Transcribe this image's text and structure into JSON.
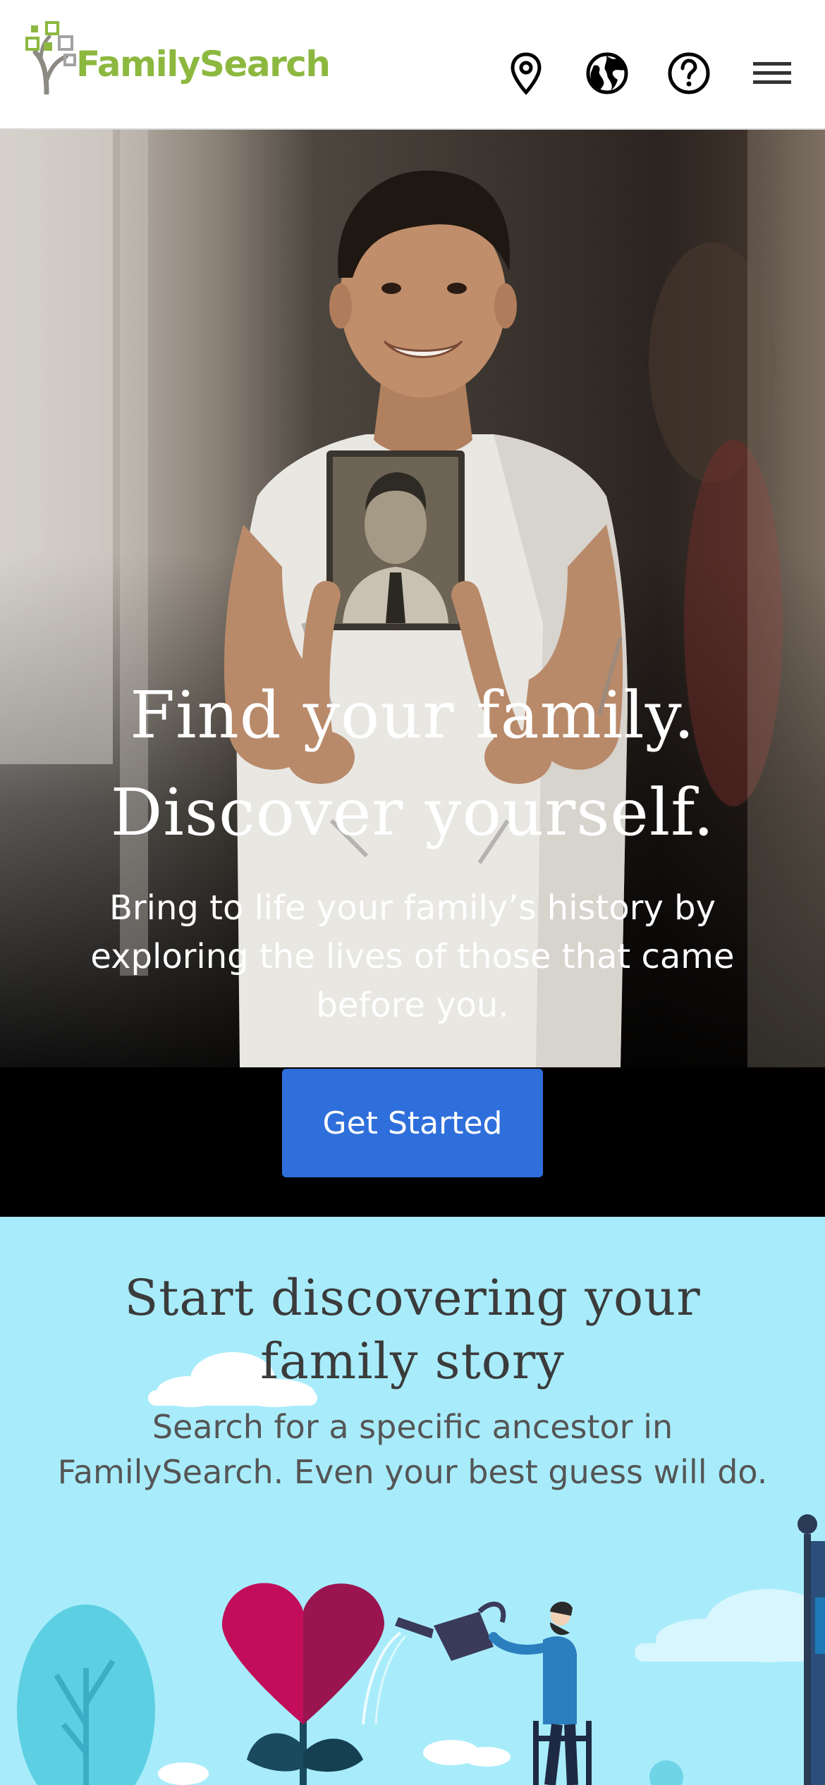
{
  "header": {
    "logo_text": "FamilySearch",
    "icons": [
      "location-pin-icon",
      "globe-icon",
      "help-icon",
      "menu-icon"
    ]
  },
  "hero": {
    "title_line1": "Find your family.",
    "title_line2": "Discover yourself.",
    "subtitle": "Bring to life your family’s history by exploring the lives of those that came before you.",
    "cta_label": "Get Started"
  },
  "discover": {
    "title": "Start discovering your family story",
    "text": "Search for a specific ancestor in FamilySearch. Even your best guess will do."
  },
  "colors": {
    "brand_green": "#8cb83f",
    "cta_blue": "#2f6fdb",
    "discover_bg": "#a8ecfb"
  }
}
